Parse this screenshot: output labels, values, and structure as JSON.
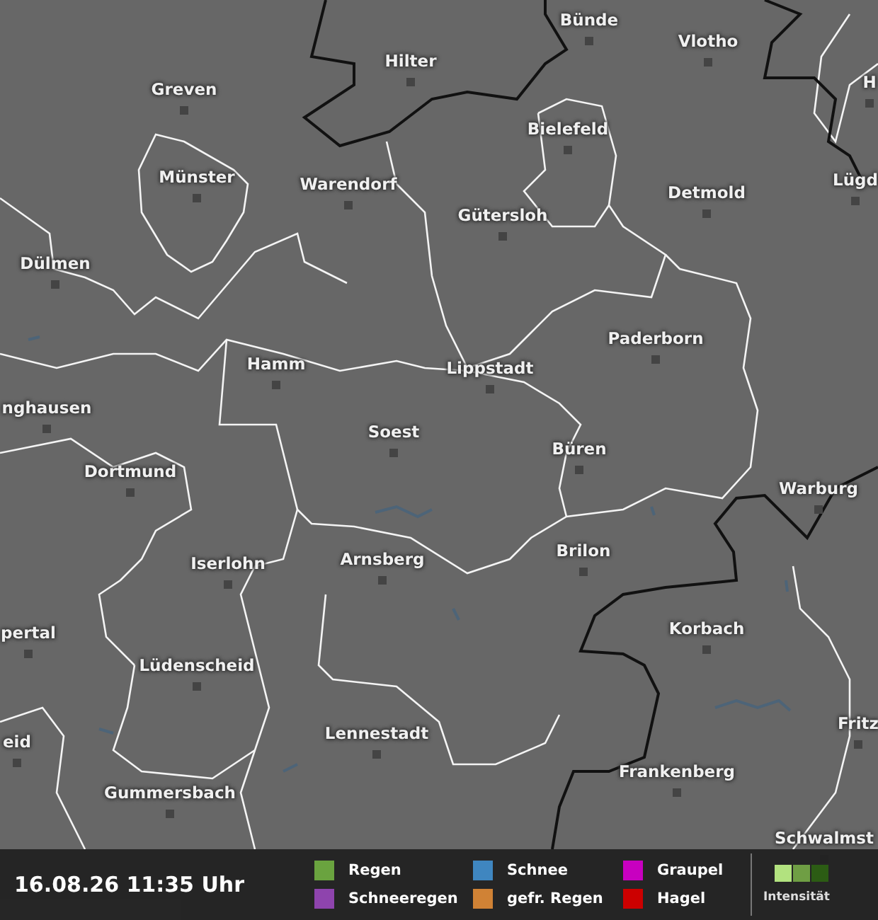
{
  "map": {
    "cities": [
      {
        "name": "Bünde"
      },
      {
        "name": "Vlotho"
      },
      {
        "name": "Hilter"
      },
      {
        "name": "H"
      },
      {
        "name": "Greven"
      },
      {
        "name": "Bielefeld"
      },
      {
        "name": "Münster"
      },
      {
        "name": "Warendorf"
      },
      {
        "name": "Detmold"
      },
      {
        "name": "Lügd"
      },
      {
        "name": "Gütersloh"
      },
      {
        "name": "Dülmen"
      },
      {
        "name": "Paderborn"
      },
      {
        "name": "Hamm"
      },
      {
        "name": "Lippstadt"
      },
      {
        "name": "nghausen"
      },
      {
        "name": "Soest"
      },
      {
        "name": "Büren"
      },
      {
        "name": "Dortmund"
      },
      {
        "name": "Warburg"
      },
      {
        "name": "Brilon"
      },
      {
        "name": "Arnsberg"
      },
      {
        "name": "Iserlohn"
      },
      {
        "name": "Korbach"
      },
      {
        "name": "pertal"
      },
      {
        "name": "Lüdenscheid"
      },
      {
        "name": "Fritz"
      },
      {
        "name": "eid"
      },
      {
        "name": "Lennestadt"
      },
      {
        "name": "Frankenberg"
      },
      {
        "name": "Gummersbach"
      },
      {
        "name": "Schwalmst"
      }
    ]
  },
  "footer": {
    "timestamp": "16.08.26 11:35 Uhr",
    "legend": [
      {
        "label": "Regen",
        "color": "#6aa33f"
      },
      {
        "label": "Schneeregen",
        "color": "#8e44ad"
      },
      {
        "label": "Schnee",
        "color": "#3f86c0"
      },
      {
        "label": "gefr. Regen",
        "color": "#d08235"
      },
      {
        "label": "Graupel",
        "color": "#c800c0"
      },
      {
        "label": "Hagel",
        "color": "#cc0000"
      }
    ],
    "intensity": {
      "label": "Intensität",
      "swatches": [
        {
          "color": "#b2e27f"
        },
        {
          "color": "#6f9e44"
        },
        {
          "color": "#2c5c14"
        }
      ]
    }
  }
}
